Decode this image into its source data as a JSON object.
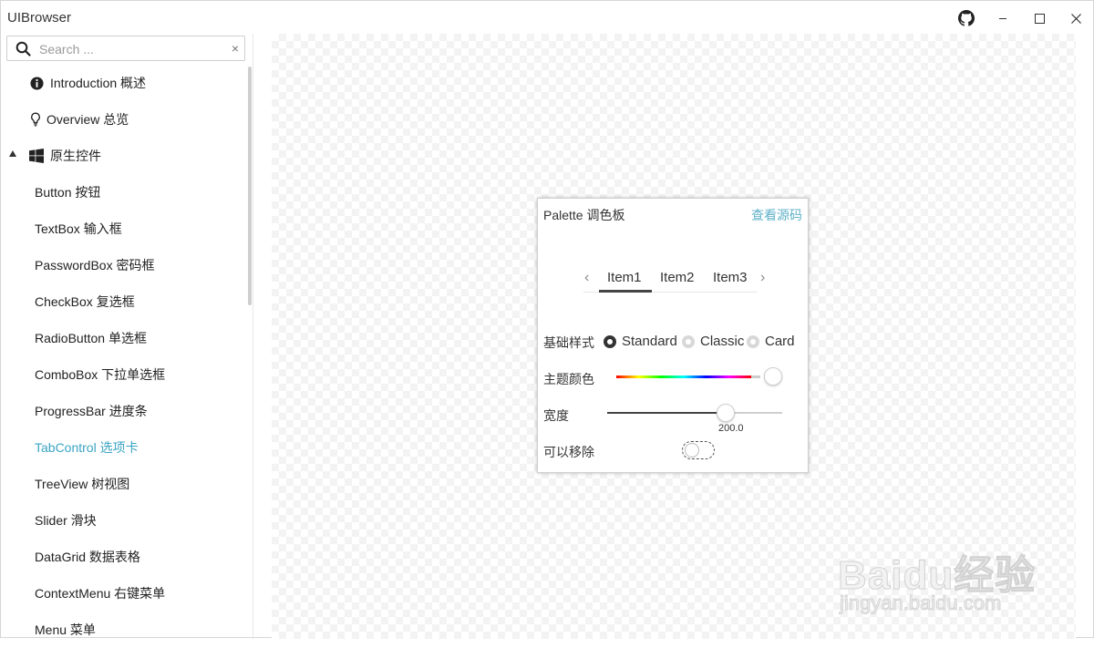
{
  "app": {
    "title": "UIBrowser"
  },
  "window_controls": {
    "github": "github-icon",
    "minimize": "minimize-icon",
    "maximize": "maximize-icon",
    "close": "close-icon"
  },
  "search": {
    "placeholder": "Search ...",
    "value": "",
    "clear": "×"
  },
  "nav": {
    "top_items": [
      {
        "label": "Introduction 概述",
        "icon": "info-icon"
      },
      {
        "label": "Overview 总览",
        "icon": "lightbulb-icon"
      }
    ],
    "group": {
      "label": "原生控件",
      "icon": "windows-icon",
      "expanded": true
    },
    "children": [
      {
        "label": "Button 按钮"
      },
      {
        "label": "TextBox 输入框"
      },
      {
        "label": "PasswordBox 密码框"
      },
      {
        "label": "CheckBox 复选框"
      },
      {
        "label": "RadioButton 单选框"
      },
      {
        "label": "ComboBox 下拉单选框"
      },
      {
        "label": "ProgressBar 进度条"
      },
      {
        "label": "TabControl 选项卡",
        "active": true
      },
      {
        "label": "TreeView 树视图"
      },
      {
        "label": "Slider 滑块"
      },
      {
        "label": "DataGrid 数据表格"
      },
      {
        "label": "ContextMenu 右键菜单"
      },
      {
        "label": "Menu 菜单"
      }
    ],
    "active_color": "#3ba5c4"
  },
  "card": {
    "title": "Palette 调色板",
    "source_link": "查看源码",
    "tabs": {
      "prev": "‹",
      "next": "›",
      "items": [
        "Item1",
        "Item2",
        "Item3"
      ],
      "selected": "Item1"
    },
    "style_label": "基础样式",
    "style_options": [
      "Standard",
      "Classic",
      "Card"
    ],
    "style_selected": "Standard",
    "theme_color_label": "主题颜色",
    "width_label": "宽度",
    "width_value": "200.0",
    "removable_label": "可以移除",
    "removable_on": false
  },
  "watermark": {
    "brand": "Baidu经验",
    "url": "jingyan.baidu.com"
  }
}
